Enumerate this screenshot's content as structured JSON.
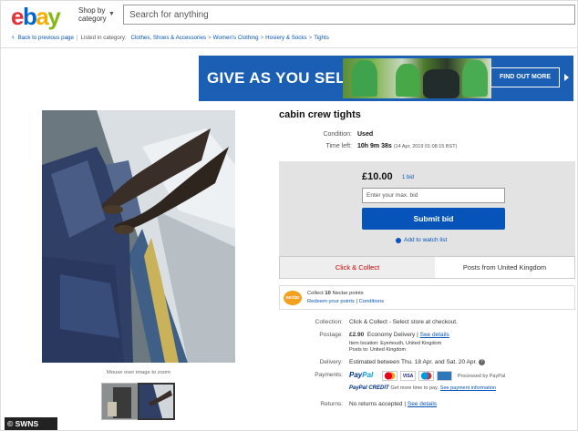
{
  "header": {
    "logo_letters": {
      "e": "e",
      "b": "b",
      "a": "a",
      "y": "y"
    },
    "shop_by_line1": "Shop by",
    "shop_by_line2": "category",
    "search_placeholder": "Search for anything"
  },
  "breadcrumb": {
    "back": "Back to previous page",
    "listed_in": "Listed in category:",
    "items": [
      "Clothes, Shoes & Accessories",
      "Women's Clothing",
      "Hosiery & Socks",
      "Tights"
    ]
  },
  "banner": {
    "headline": "GIVE AS YOU SELL",
    "cta": "FIND OUT MORE",
    "colors": {
      "background": "#1a5fb4"
    }
  },
  "gallery": {
    "zoom_hint": "Mouse over image to zoom"
  },
  "item": {
    "title": "cabin crew tights",
    "condition_label": "Condition:",
    "condition_value": "Used",
    "time_left_label": "Time left:",
    "time_left_value": "10h 9m 38s",
    "time_left_end": "(14 Apr, 2019  01:08:15 BST)"
  },
  "bid": {
    "price": "£10.00",
    "bids": "1 bid",
    "max_bid_placeholder": "Enter your max. bid",
    "submit": "Submit bid",
    "watch": "Add to watch list"
  },
  "delivery_tabs": {
    "tab1": "Click & Collect",
    "tab2": "Posts from United Kingdom"
  },
  "nectar": {
    "logo": "nectar",
    "collect_prefix": "Collect",
    "points": "10",
    "collect_suffix": "Nectar points",
    "redeem": "Redeem your points",
    "conditions": "Conditions"
  },
  "details": {
    "collection_label": "Collection:",
    "collection_value": "Click & Collect - Select store at checkout.",
    "postage_label": "Postage:",
    "postage_price": "£2.90",
    "postage_service": "Economy Delivery",
    "postage_see": "See details",
    "item_location": "Item location:  Eyemouth, United Kingdom",
    "posts_to": "Posts to:  United Kingdom",
    "delivery_label": "Delivery:",
    "delivery_value": "Estimated between Thu. 18 Apr. and Sat. 20 Apr.",
    "payments_label": "Payments:",
    "paypal_pay": "Pay",
    "paypal_pal": "Pal",
    "processed_by": "Processed by PayPal",
    "paypal_credit": "PayPal CREDIT",
    "credit_text": "Get more time to pay.",
    "credit_link": "See payment information",
    "returns_label": "Returns:",
    "returns_value": "No returns accepted",
    "returns_see": "See details"
  },
  "watermark": "© SWNS"
}
